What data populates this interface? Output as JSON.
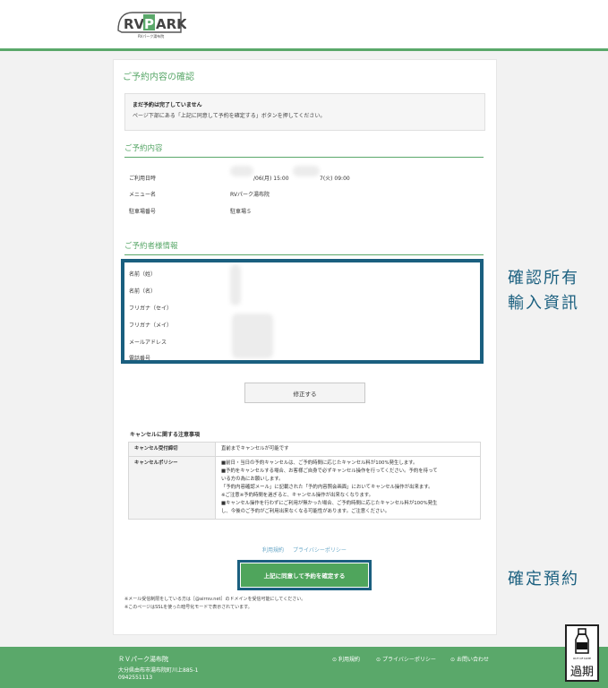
{
  "header": {
    "logo_text": "RVPARK",
    "logo_sub": "RVパーク湯布院"
  },
  "page_title": "ご予約内容の確認",
  "notice": {
    "title": "まだ予約は完了していません",
    "body": "ページ下部にある「上記に同意して予約を確定する」ボタンを押してください。"
  },
  "reservation": {
    "heading": "ご予約内容",
    "rows": [
      {
        "label": "ご利用日時",
        "value": "/06(月) 15:00",
        "value2": "7(火) 09:00"
      },
      {
        "label": "メニュー名",
        "value": "RVパーク湯布院"
      },
      {
        "label": "駐車場番号",
        "value": "駐車場５"
      }
    ]
  },
  "customer": {
    "heading": "ご予約者様情報",
    "rows": [
      {
        "label": "名前（姓）"
      },
      {
        "label": "名前（名）"
      },
      {
        "label": "フリガナ（セイ）"
      },
      {
        "label": "フリガナ（メイ）"
      },
      {
        "label": "メールアドレス"
      },
      {
        "label": "電話番号"
      }
    ]
  },
  "edit_button": "修正する",
  "cancel": {
    "heading": "キャンセルに関する注意事項",
    "rows": [
      {
        "label": "キャンセル受付締切",
        "lines": [
          "直前までキャンセルが可能です"
        ]
      },
      {
        "label": "キャンセルポリシー",
        "lines": [
          "■前日・当日の予約キャンセルは、ご予約時間に応じたキャンセル料が100%発生します。",
          "■予約をキャンセルする場合、お客様ご自身で必ずキャンセル操作を行ってください。予約を待って",
          "いる方の為にお願いします。",
          "「予約内容確認メール」に記載された「予約内容照会画面」においてキャンセル操作が出来ます。",
          "※ご注意※予約時間を過ぎると、キャンセル操作が出来なくなります。",
          "■キャンセル操作を行わずにご利用が無かった場合、ご予約時間に応じたキャンセル料が100%発生",
          "し、今後のご予約がご利用出来なくなる可能性があります。ご注意ください。"
        ]
      }
    ]
  },
  "links": {
    "terms": "利用規約",
    "privacy": "プライバシーポリシー"
  },
  "agree_button": "上記に同意して予約を確定する",
  "notes": [
    "※メール受信制限をしている方は［@airrsv.net］のドメインを受信可能にしてください。",
    "※このページはSSLを使った暗号化モードで表示されています。"
  ],
  "annotations": {
    "confirm_all": [
      "確認所有",
      "輸入資訊"
    ],
    "confirm_booking": "確定預約"
  },
  "footer": {
    "name": "ＲＶパーク湯布院",
    "address": "大分県由布市湯布院町川上885-1",
    "tel": "0942551113",
    "links": [
      "利用規約",
      "プライバシーポリシー",
      "お問い合わせ"
    ]
  },
  "stamp": {
    "top_text": "OUT OF DATE",
    "label": "過期"
  },
  "colors": {
    "accent": "#5aa86a",
    "annotation": "#1a5f7f"
  }
}
